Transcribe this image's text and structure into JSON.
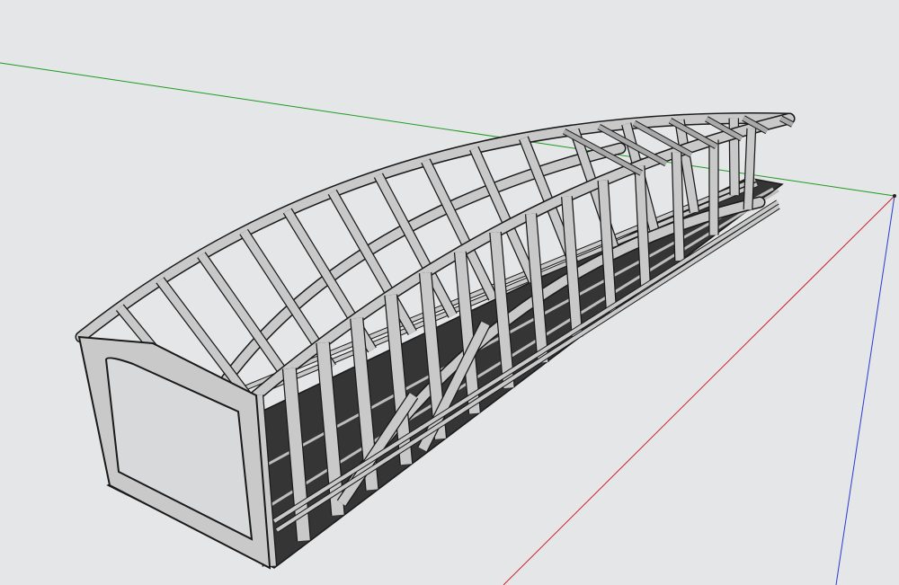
{
  "viewport": {
    "background_color": "#e4e6e8"
  },
  "axes": {
    "x_axis": {
      "color": "#1f9a1f",
      "name": "green-axis"
    },
    "y_axis": {
      "color": "#d0202a",
      "name": "red-axis"
    },
    "z_axis": {
      "color": "#2a3ad0",
      "name": "blue-axis"
    }
  },
  "model": {
    "description_name": "covered-arch-bridge",
    "frame_color": "#c9c9c9",
    "frame_shade_color": "#a9a9a9",
    "edge_color": "#1a1a1a",
    "deck_color": "#353535",
    "deck_stripe_color": "#bdbdbd"
  }
}
